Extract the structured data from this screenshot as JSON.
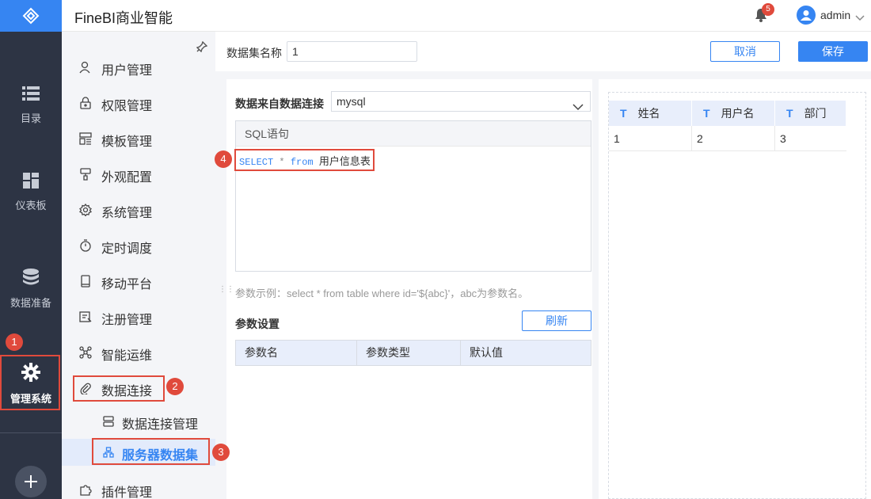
{
  "app": {
    "title": "FineBI商业智能",
    "notifications": "5",
    "user": "admin"
  },
  "rail": {
    "items": [
      {
        "label": "目录",
        "icon": "list-icon"
      },
      {
        "label": "仪表板",
        "icon": "dashboard-icon"
      },
      {
        "label": "数据准备",
        "icon": "database-icon"
      },
      {
        "label": "管理系统",
        "icon": "gear-icon"
      }
    ]
  },
  "subnav": {
    "items": [
      {
        "label": "用户管理",
        "icon": "user-icon"
      },
      {
        "label": "权限管理",
        "icon": "lock-icon"
      },
      {
        "label": "模板管理",
        "icon": "template-icon"
      },
      {
        "label": "外观配置",
        "icon": "paint-icon"
      },
      {
        "label": "系统管理",
        "icon": "settings-icon"
      },
      {
        "label": "定时调度",
        "icon": "timer-icon"
      },
      {
        "label": "移动平台",
        "icon": "mobile-icon"
      },
      {
        "label": "注册管理",
        "icon": "register-icon"
      },
      {
        "label": "智能运维",
        "icon": "ops-icon"
      },
      {
        "label": "数据连接",
        "icon": "paperclip-icon"
      },
      {
        "label": "插件管理",
        "icon": "plugin-icon"
      }
    ],
    "sub": [
      {
        "label": "数据连接管理",
        "icon": "server-icon"
      },
      {
        "label": "服务器数据集",
        "icon": "hierarchy-icon"
      }
    ]
  },
  "form": {
    "dataset_label": "数据集名称",
    "dataset_value": "1",
    "cancel": "取消",
    "save": "保存",
    "conn_label": "数据来自数据连接",
    "conn_value": "mysql",
    "sql_header": "SQL语句",
    "sql": {
      "select": "SELECT",
      "star": "*",
      "from": "from",
      "table": "用户信息表"
    },
    "hint": "参数示例：select * from table where id='${abc}'，abc为参数名。",
    "param_title": "参数设置",
    "refresh": "刷新",
    "param_cols": [
      "参数名",
      "参数类型",
      "默认值"
    ]
  },
  "preview": {
    "type_mark": "T",
    "columns": [
      "姓名",
      "用户名",
      "部门"
    ],
    "rows": [
      [
        "1",
        "2",
        "3"
      ]
    ]
  },
  "annotations": [
    "1",
    "2",
    "3",
    "4"
  ],
  "colors": {
    "accent": "#3685f2",
    "rail": "#2d3444",
    "annotation": "#e04a3c"
  }
}
